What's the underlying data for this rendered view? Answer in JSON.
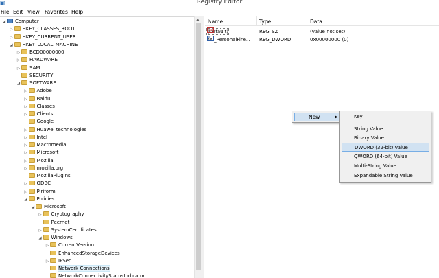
{
  "window": {
    "title": "Registry Editor",
    "icon": "regedit-icon"
  },
  "menu": [
    "File",
    "Edit",
    "View",
    "Favorites",
    "Help"
  ],
  "tree": [
    {
      "label": "Computer",
      "indent": 0,
      "exp": "◢",
      "kind": "computer"
    },
    {
      "label": "HKEY_CLASSES_ROOT",
      "indent": 1,
      "exp": "▷",
      "kind": "folder"
    },
    {
      "label": "HKEY_CURRENT_USER",
      "indent": 1,
      "exp": "▷",
      "kind": "folder"
    },
    {
      "label": "HKEY_LOCAL_MACHINE",
      "indent": 1,
      "exp": "◢",
      "kind": "folder"
    },
    {
      "label": "BCD00000000",
      "indent": 2,
      "exp": "▷",
      "kind": "folder"
    },
    {
      "label": "HARDWARE",
      "indent": 2,
      "exp": "▷",
      "kind": "folder"
    },
    {
      "label": "SAM",
      "indent": 2,
      "exp": "▷",
      "kind": "folder"
    },
    {
      "label": "SECURITY",
      "indent": 2,
      "exp": "",
      "kind": "folder"
    },
    {
      "label": "SOFTWARE",
      "indent": 2,
      "exp": "◢",
      "kind": "folder"
    },
    {
      "label": "Adobe",
      "indent": 3,
      "exp": "▷",
      "kind": "folder"
    },
    {
      "label": "Baidu",
      "indent": 3,
      "exp": "▷",
      "kind": "folder"
    },
    {
      "label": "Classes",
      "indent": 3,
      "exp": "▷",
      "kind": "folder"
    },
    {
      "label": "Clients",
      "indent": 3,
      "exp": "▷",
      "kind": "folder"
    },
    {
      "label": "Google",
      "indent": 3,
      "exp": "",
      "kind": "folder"
    },
    {
      "label": "Huawei technologies",
      "indent": 3,
      "exp": "▷",
      "kind": "folder"
    },
    {
      "label": "Intel",
      "indent": 3,
      "exp": "▷",
      "kind": "folder"
    },
    {
      "label": "Macromedia",
      "indent": 3,
      "exp": "▷",
      "kind": "folder"
    },
    {
      "label": "Microsoft",
      "indent": 3,
      "exp": "▷",
      "kind": "folder"
    },
    {
      "label": "Mozilla",
      "indent": 3,
      "exp": "▷",
      "kind": "folder"
    },
    {
      "label": "mozilla.org",
      "indent": 3,
      "exp": "▷",
      "kind": "folder"
    },
    {
      "label": "MozillaPlugins",
      "indent": 3,
      "exp": "",
      "kind": "folder"
    },
    {
      "label": "ODBC",
      "indent": 3,
      "exp": "▷",
      "kind": "folder"
    },
    {
      "label": "Piriform",
      "indent": 3,
      "exp": "▷",
      "kind": "folder"
    },
    {
      "label": "Policies",
      "indent": 3,
      "exp": "◢",
      "kind": "folder"
    },
    {
      "label": "Microsoft",
      "indent": 4,
      "exp": "◢",
      "kind": "folder"
    },
    {
      "label": "Cryptography",
      "indent": 5,
      "exp": "▷",
      "kind": "folder"
    },
    {
      "label": "Peernet",
      "indent": 5,
      "exp": "",
      "kind": "folder"
    },
    {
      "label": "SystemCertificates",
      "indent": 5,
      "exp": "▷",
      "kind": "folder"
    },
    {
      "label": "Windows",
      "indent": 5,
      "exp": "◢",
      "kind": "folder"
    },
    {
      "label": "CurrentVersion",
      "indent": 6,
      "exp": "▷",
      "kind": "folder"
    },
    {
      "label": "EnhancedStorageDevices",
      "indent": 6,
      "exp": "",
      "kind": "folder"
    },
    {
      "label": "IPSec",
      "indent": 6,
      "exp": "▷",
      "kind": "folder"
    },
    {
      "label": "Network Connections",
      "indent": 6,
      "exp": "",
      "kind": "folder",
      "selected": true
    },
    {
      "label": "NetworkConnectivityStatusIndicator",
      "indent": 6,
      "exp": "",
      "kind": "folder"
    }
  ],
  "list": {
    "headers": [
      "Name",
      "Type",
      "Data"
    ],
    "rows": [
      {
        "icon": "ab",
        "name": "(Default)",
        "type": "REG_SZ",
        "data": "(value not set)"
      },
      {
        "icon": "bin",
        "name": "NC_PersonalFire...",
        "type": "REG_DWORD",
        "data": "0x00000000 (0)"
      }
    ]
  },
  "context_menu": {
    "new_label": "New",
    "submenu": [
      "Key",
      "String Value",
      "Binary Value",
      "DWORD (32-bit) Value",
      "QWORD (64-bit) Value",
      "Multi-String Value",
      "Expandable String Value"
    ],
    "highlighted": "DWORD (32-bit) Value"
  }
}
